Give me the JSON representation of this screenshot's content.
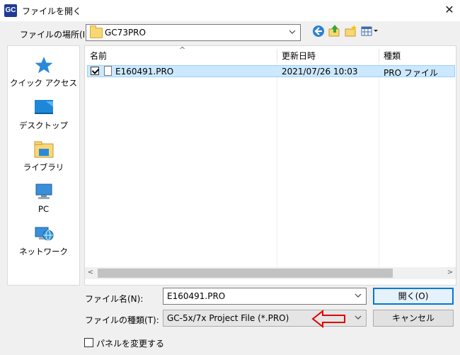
{
  "window": {
    "app_icon_text": "GC",
    "title": "ファイルを開く",
    "close_glyph": "✕"
  },
  "location": {
    "label": "ファイルの場所(I):",
    "value": "GC73PRO"
  },
  "toolbar": {
    "icons": [
      "back-icon",
      "up-folder-icon",
      "new-folder-icon",
      "view-menu-icon"
    ]
  },
  "sidebar": {
    "items": [
      {
        "label": "クイック アクセス",
        "icon": "star-icon"
      },
      {
        "label": "デスクトップ",
        "icon": "desktop-icon"
      },
      {
        "label": "ライブラリ",
        "icon": "library-icon"
      },
      {
        "label": "PC",
        "icon": "pc-icon"
      },
      {
        "label": "ネットワーク",
        "icon": "network-icon"
      }
    ]
  },
  "filelist": {
    "sort_glyph": "^",
    "columns": [
      "名前",
      "更新日時",
      "種類"
    ],
    "rows": [
      {
        "name": "E160491.PRO",
        "modified": "2021/07/26 10:03",
        "type": "PRO ファイル",
        "checked": true,
        "selected": true
      }
    ],
    "scroll_left": "<",
    "scroll_right": ">"
  },
  "form": {
    "filename_label": "ファイル名(N):",
    "filename_value": "E160491.PRO",
    "filetype_label": "ファイルの種類(T):",
    "filetype_value": "GC-5x/7x Project File (*.PRO)",
    "open_label": "開く(O)",
    "cancel_label": "キャンセル",
    "panel_checkbox_label": "パネルを変更する"
  },
  "colors": {
    "selection": "#cce8ff",
    "accent": "#0078d7",
    "annotation_arrow": "#e00000"
  }
}
